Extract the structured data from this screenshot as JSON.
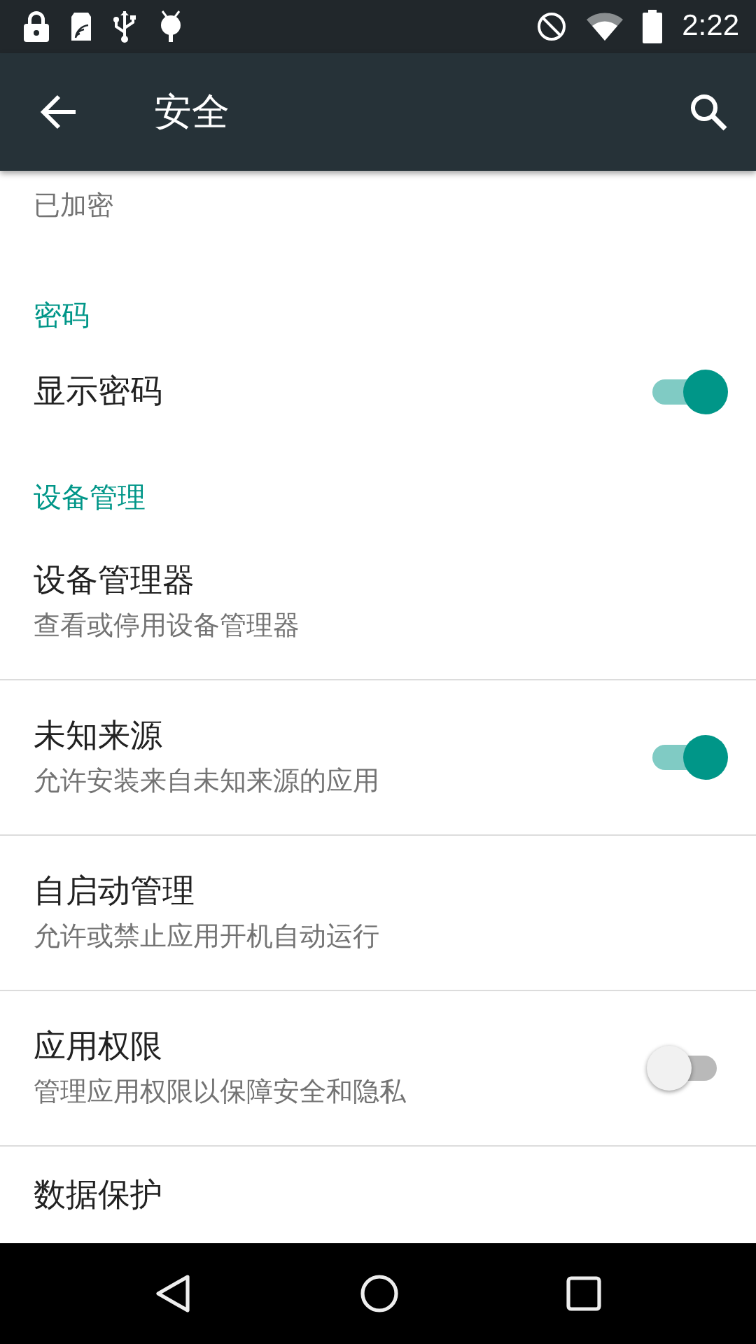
{
  "status_bar": {
    "time": "2:22"
  },
  "toolbar": {
    "title": "安全"
  },
  "items": [
    {
      "kind": "summary",
      "summary": "已加密"
    },
    {
      "kind": "header",
      "title": "密码"
    },
    {
      "kind": "switch",
      "title": "显示密码",
      "on": true
    },
    {
      "kind": "header",
      "title": "设备管理"
    },
    {
      "kind": "item",
      "title": "设备管理器",
      "summary": "查看或停用设备管理器",
      "divider": true
    },
    {
      "kind": "switch",
      "title": "未知来源",
      "summary": "允许安装来自未知来源的应用",
      "on": true,
      "divider": true
    },
    {
      "kind": "item",
      "title": "自启动管理",
      "summary": "允许或禁止应用开机自动运行",
      "divider": true
    },
    {
      "kind": "switch",
      "title": "应用权限",
      "summary": "管理应用权限以保障安全和隐私",
      "on": false,
      "divider": true
    },
    {
      "kind": "item",
      "title": "数据保护"
    }
  ]
}
